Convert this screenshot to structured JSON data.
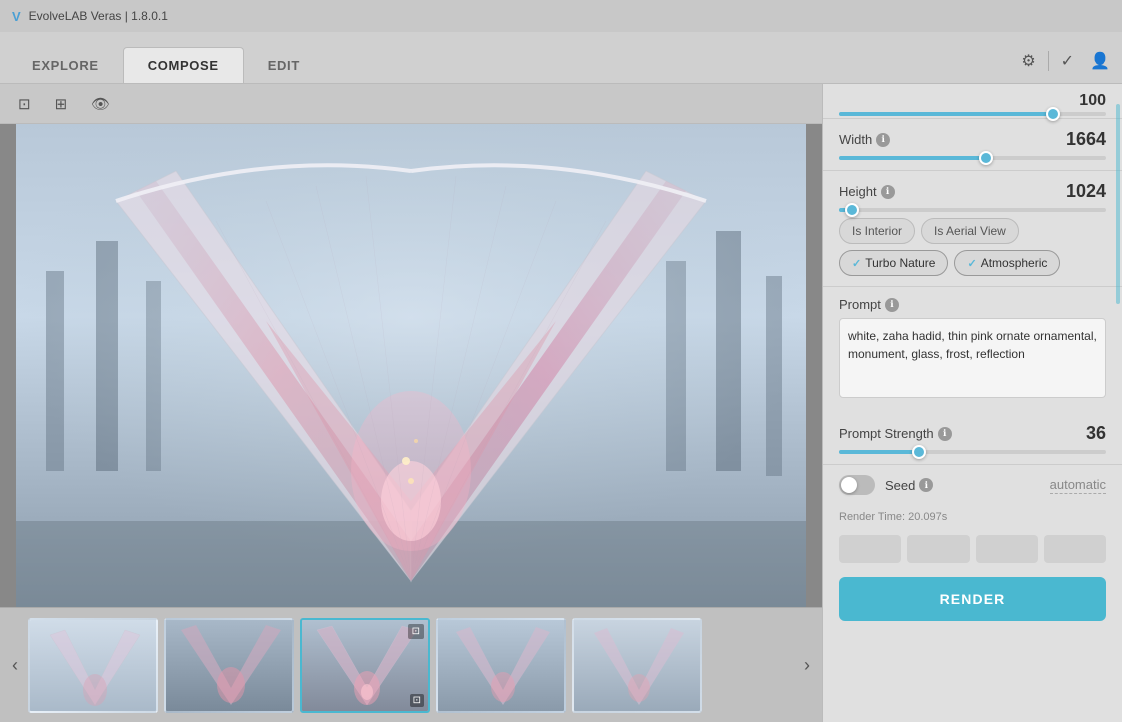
{
  "app": {
    "title": "EvolveLAB Veras | 1.8.0.1",
    "logo_icon": "V"
  },
  "nav": {
    "tabs": [
      {
        "id": "explore",
        "label": "EXPLORE"
      },
      {
        "id": "compose",
        "label": "COMPOSE"
      },
      {
        "id": "edit",
        "label": "EDIT"
      }
    ],
    "active_tab": "compose",
    "icons": [
      "settings",
      "check",
      "user"
    ]
  },
  "toolbar": {
    "tools": [
      {
        "id": "save",
        "icon": "⊡",
        "label": "save-icon"
      },
      {
        "id": "add-frame",
        "icon": "⊞",
        "label": "add-frame-icon"
      },
      {
        "id": "preview",
        "icon": "👁",
        "label": "eye-icon"
      }
    ]
  },
  "right_panel": {
    "top_slider": {
      "value": "100",
      "percent": 80
    },
    "width": {
      "label": "Width",
      "value": "1664",
      "percent": 55,
      "thumb_percent": 55
    },
    "height": {
      "label": "Height",
      "value": "1024",
      "percent": 5,
      "thumb_percent": 5
    },
    "chips": [
      {
        "id": "is-interior",
        "label": "Is Interior",
        "active": false
      },
      {
        "id": "is-aerial-view",
        "label": "Is Aerial View",
        "active": false
      },
      {
        "id": "turbo-nature",
        "label": "Turbo Nature",
        "active": true
      },
      {
        "id": "atmospheric",
        "label": "Atmospheric",
        "active": true
      }
    ],
    "prompt": {
      "label": "Prompt",
      "value": "white, zaha hadid, thin pink ornate ornamental, monument, glass, frost, reflection"
    },
    "prompt_strength": {
      "label": "Prompt Strength",
      "value": "36",
      "percent": 30,
      "thumb_percent": 30
    },
    "seed": {
      "label": "Seed",
      "value": "automatic",
      "enabled": false
    },
    "render_time": {
      "label": "Render Time:",
      "value": "20.097s"
    },
    "render_button": {
      "label": "RENDER"
    }
  },
  "thumbnails": [
    {
      "id": 1,
      "selected": false,
      "style": "thumb-1"
    },
    {
      "id": 2,
      "selected": false,
      "style": "thumb-2"
    },
    {
      "id": 3,
      "selected": true,
      "style": "thumb-3",
      "has_icon": true
    },
    {
      "id": 4,
      "selected": false,
      "style": "thumb-4"
    },
    {
      "id": 5,
      "selected": false,
      "style": "thumb-5"
    }
  ],
  "info_icon_label": "ℹ"
}
